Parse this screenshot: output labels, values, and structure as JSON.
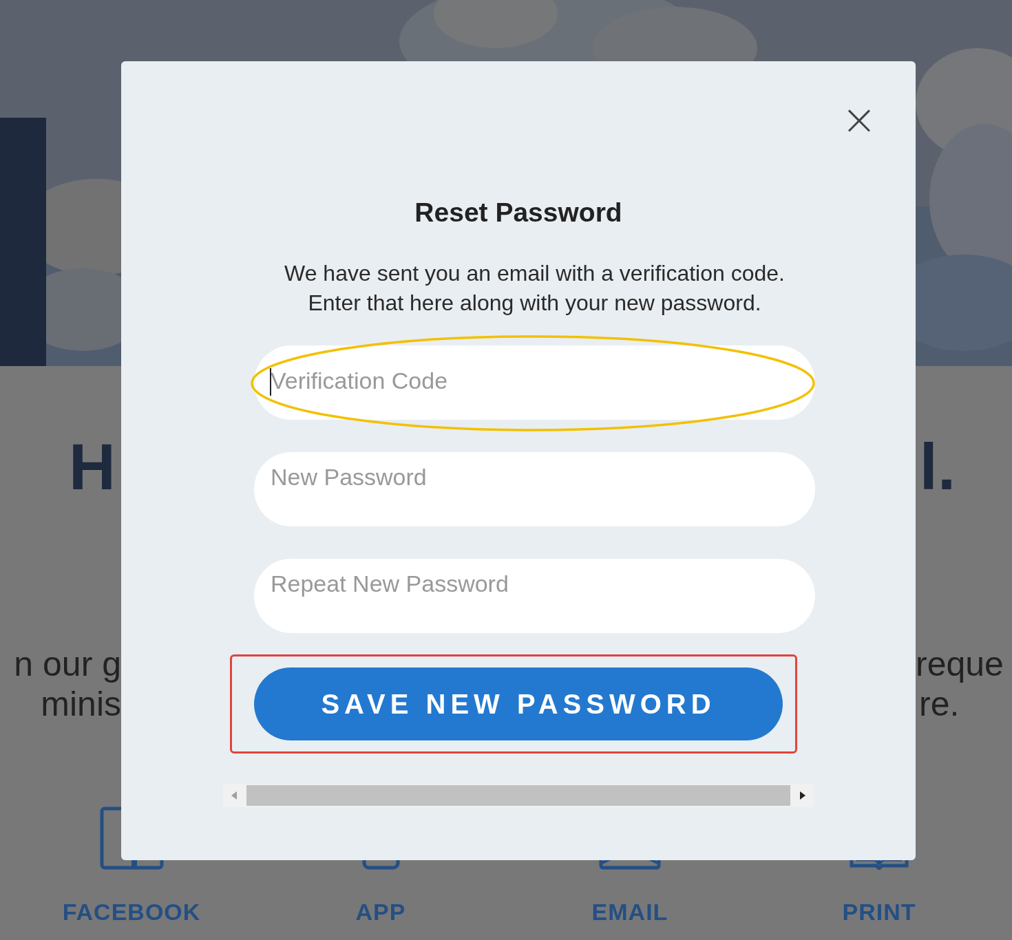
{
  "background": {
    "heading_left": "H",
    "heading_right": "l.",
    "text_left": [
      "n our g",
      "minis"
    ],
    "text_right": [
      "reque",
      "re."
    ],
    "links": [
      {
        "label": "FACEBOOK",
        "kind": "square"
      },
      {
        "label": "APP",
        "kind": "phone"
      },
      {
        "label": "EMAIL",
        "kind": "envelope"
      },
      {
        "label": "PRINT",
        "kind": "book"
      }
    ]
  },
  "dialog": {
    "close": "×",
    "title": "Reset Password",
    "message": "We have sent you an email with a verification code. Enter that here along with your new password.",
    "fields": [
      {
        "placeholder": "Verification Code",
        "focused": true,
        "annotated": true
      },
      {
        "placeholder": "New Password",
        "focused": false,
        "annotated": false
      },
      {
        "placeholder": "Repeat New Password",
        "focused": false,
        "annotated": false
      }
    ],
    "button": {
      "label": "SAVE NEW PASSWORD",
      "annotated": true
    }
  }
}
